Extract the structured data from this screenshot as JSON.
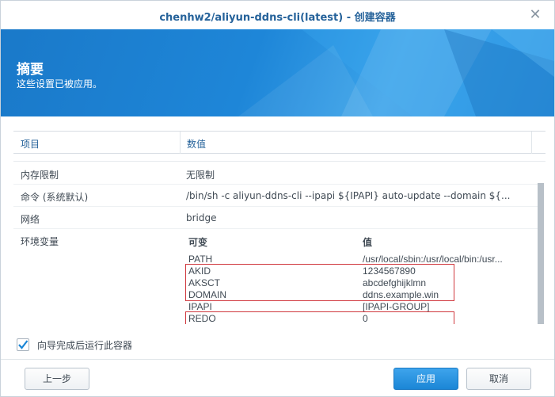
{
  "window": {
    "title": "chenhw2/aliyun-ddns-cli(latest) - 创建容器",
    "close_icon": "close-icon"
  },
  "banner": {
    "title": "摘要",
    "subtitle": "这些设置已被应用。"
  },
  "table": {
    "headers": [
      "项目",
      "数值"
    ],
    "rows": [
      {
        "key": "内存限制",
        "value": "无限制"
      },
      {
        "key": "命令 (系统默认)",
        "value": "/bin/sh -c aliyun-ddns-cli --ipapi ${IPAPI} auto-update --domain ${..."
      },
      {
        "key": "网络",
        "value": "bridge"
      },
      {
        "key": "环境变量",
        "value": ""
      }
    ]
  },
  "env": {
    "headers": [
      "可变",
      "值"
    ],
    "items": [
      {
        "name": "PATH",
        "value": "/usr/local/sbin:/usr/local/bin:/usr..."
      },
      {
        "name": "AKID",
        "value": "1234567890"
      },
      {
        "name": "AKSCT",
        "value": "abcdefghijklmn"
      },
      {
        "name": "DOMAIN",
        "value": "ddns.example.win"
      },
      {
        "name": "IPAPI",
        "value": "[IPAPI-GROUP]"
      },
      {
        "name": "REDO",
        "value": "0"
      }
    ]
  },
  "footer": {
    "checkbox_label": "向导完成后运行此容器",
    "checkbox_checked": true,
    "back_label": "上一步",
    "apply_label": "应用",
    "cancel_label": "取消"
  },
  "colors": {
    "accent": "#1b86d6",
    "title": "#25629a",
    "highlight": "#d0383e"
  }
}
